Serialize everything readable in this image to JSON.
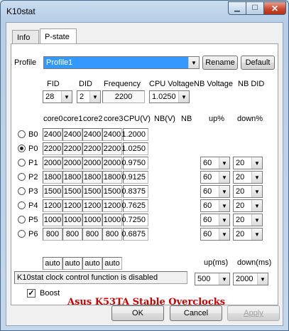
{
  "window": {
    "title": "K10stat"
  },
  "tabs": [
    {
      "label": "Info"
    },
    {
      "label": "P-state"
    }
  ],
  "profile": {
    "label": "Profile",
    "value": "Profile1",
    "rename": "Rename",
    "default": "Default"
  },
  "headers": {
    "fid": "FID",
    "did": "DID",
    "frequency": "Frequency",
    "cpu_voltage": "CPU Voltage",
    "nb_voltage": "NB Voltage",
    "nb_did": "NB DID"
  },
  "top_controls": {
    "fid": "28",
    "did": "2",
    "frequency": "2200",
    "cpu_voltage": "1.0250"
  },
  "grid_headers": [
    "core0",
    "core1",
    "core2",
    "core3",
    "CPU(V)",
    "NB(V)",
    "NB",
    "up%",
    "down%"
  ],
  "states": [
    {
      "name": "B0",
      "cores": [
        "2400",
        "2400",
        "2400",
        "2400"
      ],
      "cpuv": "1.2000",
      "selected": false
    },
    {
      "name": "P0",
      "cores": [
        "2200",
        "2200",
        "2200",
        "2200"
      ],
      "cpuv": "1.0250",
      "selected": true
    },
    {
      "name": "P1",
      "cores": [
        "2000",
        "2000",
        "2000",
        "2000"
      ],
      "cpuv": "0.9750",
      "up": "60",
      "down": "20",
      "selected": false
    },
    {
      "name": "P2",
      "cores": [
        "1800",
        "1800",
        "1800",
        "1800"
      ],
      "cpuv": "0.9125",
      "up": "60",
      "down": "20",
      "selected": false
    },
    {
      "name": "P3",
      "cores": [
        "1500",
        "1500",
        "1500",
        "1500"
      ],
      "cpuv": "0.8375",
      "up": "60",
      "down": "20",
      "selected": false
    },
    {
      "name": "P4",
      "cores": [
        "1200",
        "1200",
        "1200",
        "1200"
      ],
      "cpuv": "0.7625",
      "up": "60",
      "down": "20",
      "selected": false
    },
    {
      "name": "P5",
      "cores": [
        "1000",
        "1000",
        "1000",
        "1000"
      ],
      "cpuv": "0.7250",
      "up": "60",
      "down": "20",
      "selected": false
    },
    {
      "name": "P6",
      "cores": [
        "800",
        "800",
        "800",
        "800"
      ],
      "cpuv": "0.6875",
      "up": "60",
      "down": "20",
      "selected": false
    }
  ],
  "auto_row": [
    "auto",
    "auto",
    "auto",
    "auto"
  ],
  "timing": {
    "up_label": "up(ms)",
    "down_label": "down(ms)",
    "up": "500",
    "down": "2000"
  },
  "status": {
    "text": "K10stat clock control function is disabled"
  },
  "boost": {
    "label": "Boost",
    "checked": true
  },
  "brand": {
    "text": "Asus K53TA Stable Overclocks",
    "color": "#c80000"
  },
  "buttons": {
    "ok": "OK",
    "cancel": "Cancel",
    "apply": "Apply"
  }
}
